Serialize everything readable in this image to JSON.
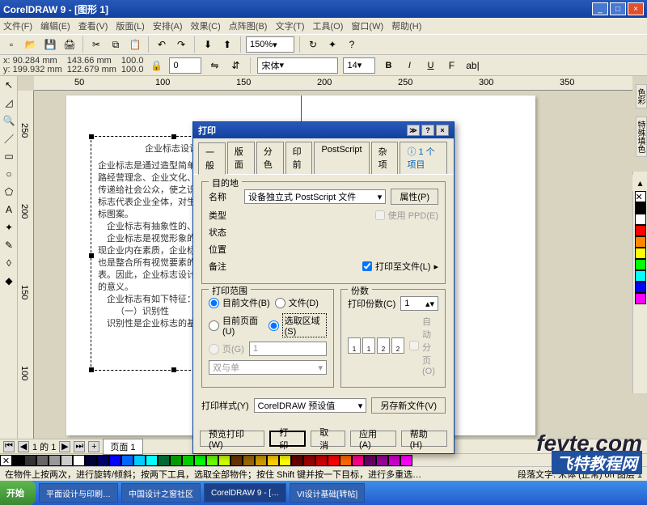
{
  "window": {
    "title": "CorelDRAW 9 - [图形 1]",
    "min": "_",
    "max": "□",
    "close": "×"
  },
  "menu": [
    "文件(F)",
    "编辑(E)",
    "查看(V)",
    "版面(L)",
    "安排(A)",
    "效果(C)",
    "点阵图(B)",
    "文字(T)",
    "工具(O)",
    "窗口(W)",
    "帮助(H)"
  ],
  "toolbar": {
    "zoom": "150%",
    "icons": [
      "▢",
      "▢",
      "▢",
      "▢",
      "▢"
    ]
  },
  "propbar": {
    "x": "x: 90.284 mm",
    "y": "y: 199.932 mm",
    "w": "143.66 mm",
    "h": "122.679 mm",
    "sx": "100.0",
    "sy": "100.0",
    "rot": "0",
    "font": "宋体",
    "size": "14"
  },
  "ruler_h": [
    "50",
    "100",
    "150",
    "200",
    "250",
    "300",
    "350"
  ],
  "ruler_v": [
    "250",
    "200",
    "150",
    "100"
  ],
  "document": {
    "title": "企业标志设计",
    "p1": "企业标志是通过造型简单、意",
    "p2": "路经营理念、企业文化、经营内容",
    "p3": "传递给社会公众，使之识别和认知",
    "p4": "标志代表企业全体，对生产、销售",
    "p5": "标图案。",
    "p6": "企业标志有抽象性的、具象性",
    "p7": "企业标志是视觉形象的核心",
    "p8": "现企业内在素质，企业标志不仅是",
    "p9": "也是整合所有视觉要素的中心，是",
    "p10": "表。因此，企业标志设计，在整个",
    "p11": "的意义。",
    "p12": "企业标志有如下特征：",
    "p13": "（一）识别性",
    "p14": "识别性是企业标志的基本功能"
  },
  "dialog": {
    "title": "打印",
    "tabs": [
      "一般",
      "版面",
      "分色",
      "印前",
      "PostScript",
      "杂项"
    ],
    "info_tab": "1 个项目",
    "dest_group": "目的地",
    "name_label": "名称",
    "printer": "设备独立式 PostScript 文件",
    "properties_btn": "属性(P)",
    "use_ppd": "使用 PPD(E)",
    "status_label": "状态",
    "type_label": "类型",
    "where_label": "位置",
    "comment_label": "备注",
    "to_file": "打印至文件(L)",
    "range_group": "打印范围",
    "current_doc": "目前文件(B)",
    "documents": "文件(D)",
    "current_page": "目前页面(U)",
    "selection": "选取区域(S)",
    "pages_label": "页(G)",
    "pages_val": "1",
    "even_odd": "双与单",
    "copies_group": "份数",
    "copies_label": "打印份数(C)",
    "copies_val": "1",
    "collate": "自动分页(O)",
    "style_label": "打印样式(Y)",
    "style_val": "CorelDRAW 预设值",
    "save_as": "另存新文件(V)",
    "preview_btn": "预览打印(W)",
    "print_btn": "打印",
    "cancel_btn": "取消",
    "apply_btn": "应用(A)",
    "help_btn": "帮助(H)"
  },
  "pagebar": {
    "text": "1 的 1",
    "page": "页面  1"
  },
  "status": {
    "left": "在物件上按两次，进行旋转/倾斜；按两下工具，选取全部物件；按住 Shift 键并按一下目标，进行多重选…",
    "right": "段落文字: 宋体 (正常) on 图层 1"
  },
  "palette_side": [
    "色彩",
    "特殊填色"
  ],
  "taskbar": {
    "start": "开始",
    "items": [
      "平面设计与印刷…",
      "中国设计之窗社区",
      "CorelDRAW 9 - […",
      "VI设计基础[转帖]"
    ]
  },
  "watermark": "fevte.com",
  "watermark2": "飞特教程网"
}
